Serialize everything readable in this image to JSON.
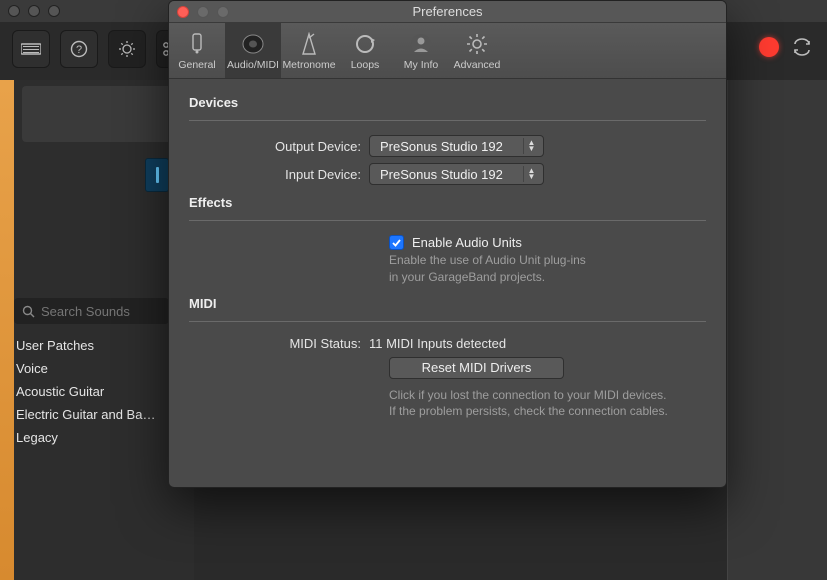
{
  "appBackground": {
    "searchPlaceholder": "Search Sounds",
    "sidebarItems": [
      "User Patches",
      "Voice",
      "Acoustic Guitar",
      "Electric Guitar and Ba…",
      "Legacy"
    ]
  },
  "pref": {
    "title": "Preferences",
    "tabs": [
      {
        "id": "general",
        "label": "General"
      },
      {
        "id": "audiomidi",
        "label": "Audio/MIDI"
      },
      {
        "id": "metronome",
        "label": "Metronome"
      },
      {
        "id": "loops",
        "label": "Loops"
      },
      {
        "id": "myinfo",
        "label": "My Info"
      },
      {
        "id": "advanced",
        "label": "Advanced"
      }
    ],
    "devices": {
      "heading": "Devices",
      "outputLabel": "Output Device:",
      "outputValue": "PreSonus Studio 192",
      "inputLabel": "Input Device:",
      "inputValue": "PreSonus Studio 192"
    },
    "effects": {
      "heading": "Effects",
      "checkboxLabel": "Enable Audio Units",
      "help": "Enable the use of Audio Unit plug-ins\nin your GarageBand projects."
    },
    "midi": {
      "heading": "MIDI",
      "statusLabel": "MIDI Status:",
      "statusValue": "11 MIDI Inputs detected",
      "resetLabel": "Reset MIDI Drivers",
      "help": "Click if you lost the connection to your MIDI devices.\nIf the problem persists, check the connection cables."
    }
  }
}
